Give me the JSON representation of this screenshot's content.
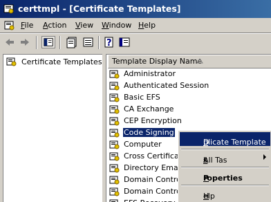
{
  "window": {
    "title": "certtmpl - [Certificate Templates]"
  },
  "menu": {
    "items": [
      {
        "label": "File",
        "accel": "F",
        "rest": "ile"
      },
      {
        "label": "Action",
        "accel": "A",
        "rest": "ction"
      },
      {
        "label": "View",
        "accel": "V",
        "rest": "iew"
      },
      {
        "label": "Window",
        "accel": "W",
        "rest": "indow"
      },
      {
        "label": "Help",
        "accel": "H",
        "rest": "elp"
      }
    ]
  },
  "tree": {
    "root_label": "Certificate Templates"
  },
  "list": {
    "column_header": "Template Display Name",
    "rows": [
      "Administrator",
      "Authenticated Session",
      "Basic EFS",
      "CA Exchange",
      "CEP Encryption",
      "Code Signing",
      "Computer",
      "Cross Certification",
      "Directory Email R",
      "Domain Controlle",
      "Domain Controlle",
      "EFS Recovery Agent"
    ],
    "selected_index": 5
  },
  "context_menu": {
    "duplicate": {
      "pre": "D",
      "accel": "u",
      "post": "plicate Template"
    },
    "all_tasks": {
      "pre": "All Tas",
      "accel": "k",
      "post": "s"
    },
    "properties": {
      "pre": "",
      "accel": "P",
      "post": "roperties"
    },
    "help": {
      "pre": "",
      "accel": "H",
      "post": "elp"
    }
  },
  "colors": {
    "selection": "#0a246a",
    "title_start": "#0a246a",
    "title_end": "#3a6ea5",
    "face": "#d4d0c8"
  }
}
